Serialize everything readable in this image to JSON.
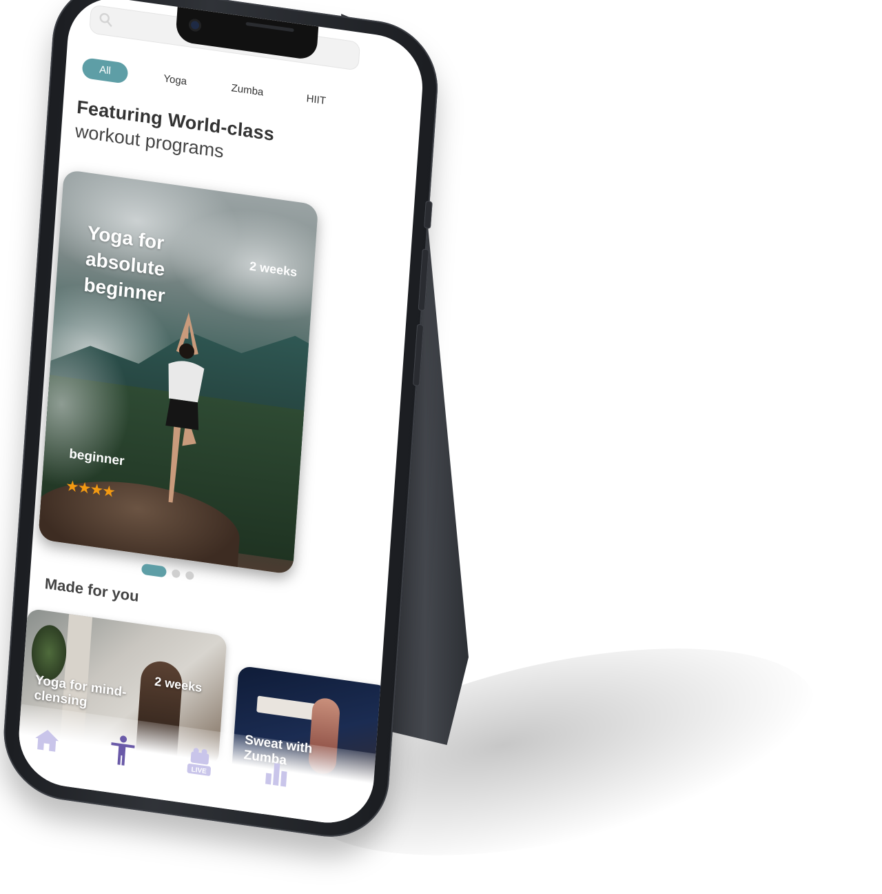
{
  "tabs": [
    {
      "label": "All",
      "active": true
    },
    {
      "label": "Yoga",
      "active": false
    },
    {
      "label": "Zumba",
      "active": false
    },
    {
      "label": "HIIT",
      "active": false
    }
  ],
  "heading": {
    "strong": "Featuring World-class",
    "light": "workout programs"
  },
  "featured": {
    "title": "Yoga for absolute beginner",
    "duration": "2 weeks",
    "level": "beginner",
    "rating": 4,
    "stars": "★★★★"
  },
  "pagination": {
    "count": 3,
    "active_index": 0
  },
  "made_for_you": {
    "title": "Made for you",
    "cards": [
      {
        "title": "Yoga for mind-clensing",
        "duration": "2 weeks"
      },
      {
        "title": "Sweat with Zumba",
        "duration": ""
      }
    ]
  },
  "bottom_nav": [
    {
      "icon": "home-icon",
      "active": false
    },
    {
      "icon": "workout-figure-icon",
      "active": true
    },
    {
      "icon": "live-icon",
      "active": false,
      "badge": "LIVE"
    },
    {
      "icon": "stats-chart-icon",
      "active": false
    }
  ],
  "colors": {
    "accent": "#5e9ea6",
    "star": "#f39a12",
    "nav_active": "#6a5aa8",
    "nav_inactive": "#c9c5ea"
  }
}
